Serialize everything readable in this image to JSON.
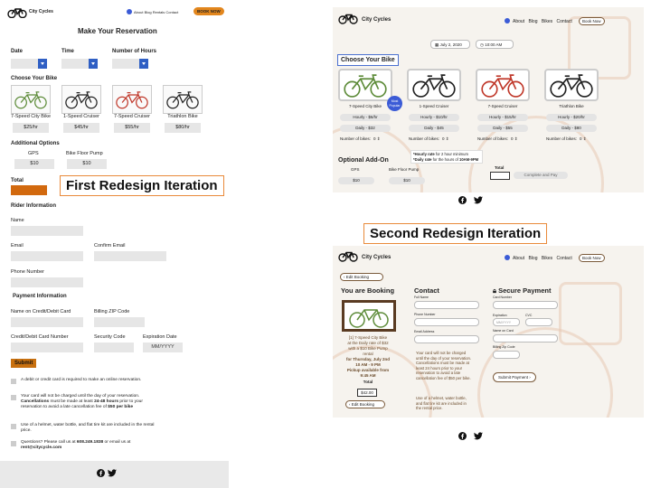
{
  "brand": "City Cycles",
  "v1": {
    "nav": [
      "About",
      "Blog",
      "Rentals",
      "Contact"
    ],
    "book_now": "BOOK NOW",
    "title": "Make Your Reservation",
    "date_label": "Date",
    "time_label": "Time",
    "hours_label": "Number of Hours",
    "choose_bike": "Choose Your Bike",
    "bikes": [
      {
        "name": "7-Speed City Bike",
        "price": "$25/hr",
        "color": "#5e8c3a"
      },
      {
        "name": "1-Speed Cruiser",
        "price": "$45/hr",
        "color": "#222222"
      },
      {
        "name": "7-Speed Cruiser",
        "price": "$55/hr",
        "color": "#c0392b"
      },
      {
        "name": "Triathlon Bike",
        "price": "$80/hr",
        "color": "#222222"
      }
    ],
    "additional_options": "Additional Options",
    "options": [
      {
        "name": "GPS",
        "price": "$10"
      },
      {
        "name": "Bike Floor Pump",
        "price": "$10"
      }
    ],
    "total_label": "Total",
    "rider_info": "Rider Information",
    "name_label": "Name",
    "email_label": "Email",
    "confirm_email_label": "Confirm Email",
    "phone_label": "Phone Number",
    "payment_info": "Payment Information",
    "card_name_label": "Name on Credit/Debit Card",
    "zip_label": "Billing ZIP Code",
    "card_number_label": "Credit/Debit Card Number",
    "security_label": "Security Code",
    "expiration_label": "Expiration Date",
    "expiration_placeholder": "MM/YYYY",
    "submit": "Submit",
    "notice_1": "A debit or credit card is required to make an online reservation.",
    "notice_2a": "Your card will not be charged until the day of your reservation. ",
    "notice_2b": "Cancellations",
    "notice_2c": " must be made at least ",
    "notice_2d": "24-48 hours",
    "notice_2e": " prior to your reservation to avoid a late cancellation fee of ",
    "notice_2f": "$50 per bike",
    "notice_3": "Use of a helmet, water bottle, and flat tire kit are included in the rental price.",
    "notice_4a": "Questions? Please call us at ",
    "notice_4b": "608.249.1838",
    "notice_4c": " or email us at ",
    "notice_4d": "rent@citycycle.com"
  },
  "caption_first": "First Redesign Iteration",
  "caption_second": "Second Redesign Iteration",
  "v2": {
    "nav": [
      "About",
      "Blog",
      "Bikes",
      "Contact"
    ],
    "book_now": "Book Now",
    "date_value": "July 2, 2020",
    "time_value": "10:00 AM",
    "choose_bike": "Choose Your Bike",
    "most_popular": "Most Popular",
    "bikes": [
      {
        "name": "7-Speed City Bike",
        "hourly": "Hourly - $6/hr",
        "daily": "Daily - $32",
        "color": "#5e8c3a"
      },
      {
        "name": "1-Speed Cruiser",
        "hourly": "Hourly - $10/hr",
        "daily": "Daily - $45",
        "color": "#222222"
      },
      {
        "name": "7-Speed Cruiser",
        "hourly": "Hourly - $15/hr",
        "daily": "Daily - $55",
        "color": "#c0392b"
      },
      {
        "name": "Triathlon Bike",
        "hourly": "Hourly - $20/hr",
        "daily": "Daily - $80",
        "color": "#222222"
      }
    ],
    "num_bikes_label": "Number of bikes:",
    "num_bikes_value": "0",
    "note_hourly_bold": "*Hourly rate",
    "note_hourly_rest": " for 2 hour minimum",
    "note_daily_bold": "*Daily rate",
    "note_daily_rest": " for the hours of ",
    "note_daily_hours": "10AM-9PM",
    "optional_addon": "Optional Add-On",
    "options": [
      {
        "name": "GPS",
        "price": "$10"
      },
      {
        "name": "Bike Floor Pump",
        "price": "$10"
      }
    ],
    "total_label": "Total",
    "complete_pay": "Complete and Pay"
  },
  "v3": {
    "nav": [
      "About",
      "Blog",
      "Bikes",
      "Contact"
    ],
    "book_now": "Book Now",
    "edit_booking": "Edit Booking",
    "you_are_booking": "You are Booking",
    "booking_line1": "[1] 7-Speed City Bike",
    "booking_line2": "at the Daily rate of $32",
    "booking_line3": "with a $10 Bike Pump",
    "booking_line4": "rental",
    "booking_line5": "for Thursday, July 2nd",
    "booking_line6": "10 AM - 9 PM",
    "booking_line7": "Pickup available from",
    "booking_line8": "9:45 AM",
    "total_label": "Total",
    "total_value": "$42.00",
    "contact": "Contact",
    "full_name": "Full Name",
    "phone_number": "Phone Number",
    "email_address": "Email Address",
    "card_notice": "Your card will not be charged until the day of your reservation. Cancellations must be made at least 24 hours prior to your reservation to avoid a late cancellation fee of $50 per bike.",
    "helmet_notice": "Use of a helmet, water bottle, and flat tire kit are included in the rental price.",
    "secure_payment": "Secure Payment",
    "card_number": "Card Number",
    "expiration": "Expiration",
    "cvc": "CVC",
    "mm_yyyy": "MM/YYYY",
    "name_on_card": "Name on Card",
    "billing_zip": "Billing Zip Code",
    "submit_payment": "Submit Payment"
  }
}
